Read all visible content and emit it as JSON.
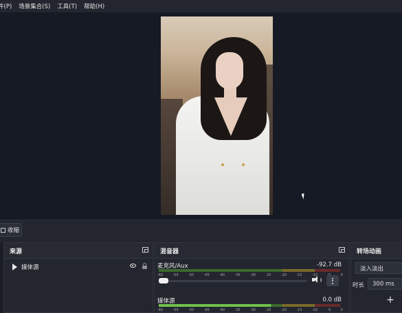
{
  "menubar": {
    "items": [
      "件(P)",
      "场景集合(S)",
      "工具(T)",
      "帮助(H)"
    ]
  },
  "toolbar": {
    "button_label": "收缩"
  },
  "sources": {
    "title": "来源",
    "items": [
      {
        "name": "媒体源"
      }
    ]
  },
  "mixer": {
    "title": "混音器",
    "scale": [
      "-60",
      "-55",
      "-50",
      "-45",
      "-40",
      "-35",
      "-30",
      "-25",
      "-20",
      "-15",
      "-10",
      "-5",
      "0"
    ],
    "channels": [
      {
        "name": "麦克风/Aux",
        "db": "-92.7 dB"
      },
      {
        "name": "媒体源",
        "db": "0.0 dB"
      }
    ]
  },
  "transitions": {
    "title": "转场动画",
    "selected": "淡入淡出",
    "duration_label": "时长",
    "duration_value": "300 ms"
  },
  "colors": {
    "accent": "#6ec24c",
    "panel": "#23262e",
    "preview": "#161a24"
  }
}
